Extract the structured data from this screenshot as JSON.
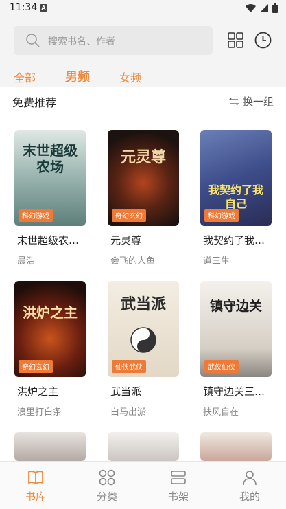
{
  "status": {
    "time": "11:34",
    "notif_letter": "A"
  },
  "search": {
    "placeholder": "搜索书名、作者"
  },
  "tabs": [
    {
      "label": "全部",
      "active": false
    },
    {
      "label": "男频",
      "active": true
    },
    {
      "label": "女频",
      "active": false
    }
  ],
  "section": {
    "title": "免费推荐",
    "refresh_label": "换一组"
  },
  "books": [
    {
      "title": "末世超级农…",
      "author": "晨浩",
      "tag": "科幻游戏",
      "cover_text": "末世超级农场",
      "cover_color": "#7fa3a0"
    },
    {
      "title": "元灵尊",
      "author": "会飞的人鱼",
      "tag": "奇幻玄幻",
      "cover_text": "元灵尊",
      "cover_color": "#2b1e1a"
    },
    {
      "title": "我契约了我…",
      "author": "道三生",
      "tag": "科幻游戏",
      "cover_text": "我契约了我自己",
      "cover_color": "#3f4f8c"
    },
    {
      "title": "洪炉之主",
      "author": "浪里打白条",
      "tag": "奇幻玄幻",
      "cover_text": "洪炉之主",
      "cover_color": "#3a1a14"
    },
    {
      "title": "武当派",
      "author": "白马出淤",
      "tag": "仙侠武侠",
      "cover_text": "武当派",
      "cover_color": "#ece4d6"
    },
    {
      "title": "镇守边关三…",
      "author": "扶风自在",
      "tag": "武侠仙侠",
      "cover_text": "镇守边关",
      "cover_color": "#e8e2da"
    }
  ],
  "nav": [
    {
      "label": "书库",
      "icon": "book-icon",
      "active": true
    },
    {
      "label": "分类",
      "icon": "category-icon",
      "active": false
    },
    {
      "label": "书架",
      "icon": "shelf-icon",
      "active": false
    },
    {
      "label": "我的",
      "icon": "profile-icon",
      "active": false
    }
  ],
  "colors": {
    "accent": "#f08a3a",
    "tag": "#f07a35"
  }
}
